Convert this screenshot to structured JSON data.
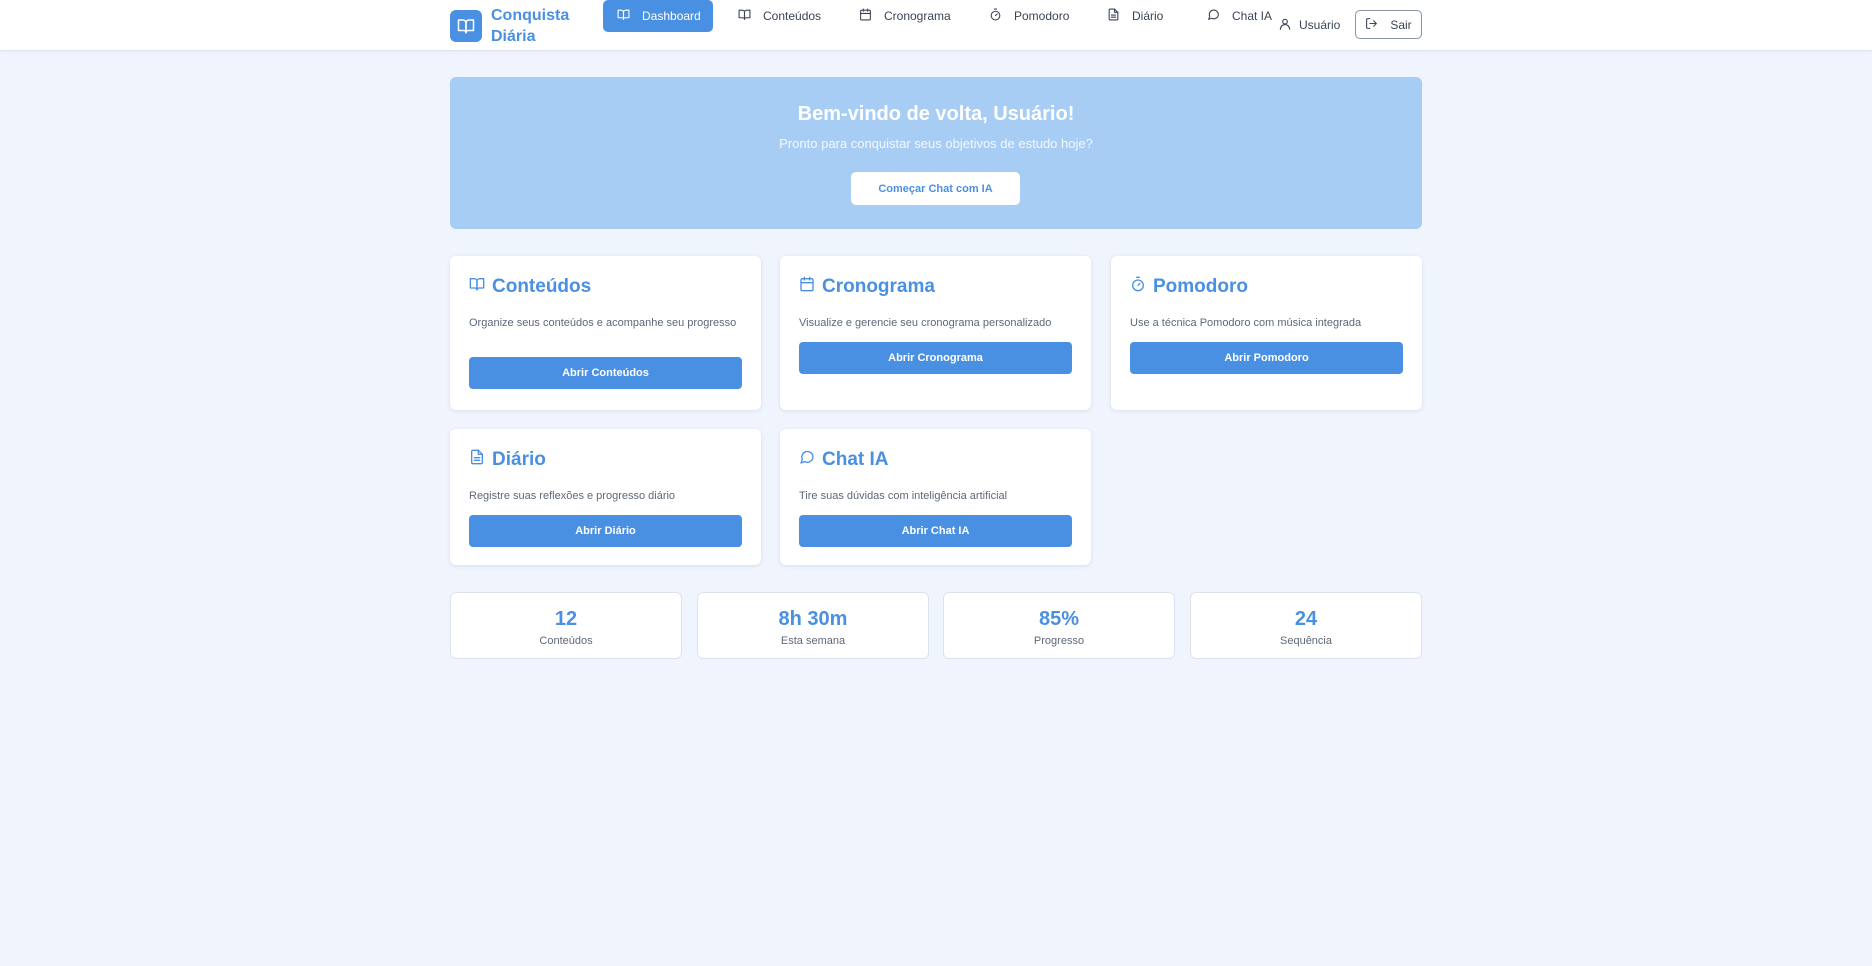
{
  "app": {
    "name": "Conquista Diária"
  },
  "nav": {
    "items": [
      {
        "label": "Dashboard",
        "icon": "book-open-icon",
        "active": true
      },
      {
        "label": "Conteúdos",
        "icon": "book-open-icon"
      },
      {
        "label": "Cronograma",
        "icon": "calendar-icon"
      },
      {
        "label": "Pomodoro",
        "icon": "timer-icon"
      },
      {
        "label": "Diário",
        "icon": "file-text-icon"
      },
      {
        "label": "Chat IA",
        "icon": "message-circle-icon"
      }
    ],
    "user_label": "Usuário",
    "logout_label": "Sair"
  },
  "hero": {
    "title": "Bem-vindo de volta, Usuário!",
    "subtitle": "Pronto para conquistar seus objetivos de estudo hoje?",
    "cta_label": "Começar Chat com IA"
  },
  "cards": [
    {
      "title": "Conteúdos",
      "icon": "book-open-icon",
      "description": "Organize seus conteúdos e acompanhe seu progresso",
      "button_label": "Abrir Conteúdos"
    },
    {
      "title": "Cronograma",
      "icon": "calendar-icon",
      "description": "Visualize e gerencie seu cronograma personalizado",
      "button_label": "Abrir Cronograma"
    },
    {
      "title": "Pomodoro",
      "icon": "timer-icon",
      "description": "Use a técnica Pomodoro com música integrada",
      "button_label": "Abrir Pomodoro"
    },
    {
      "title": "Diário",
      "icon": "file-text-icon",
      "description": "Registre suas reflexões e progresso diário",
      "button_label": "Abrir Diário"
    },
    {
      "title": "Chat IA",
      "icon": "message-circle-icon",
      "description": "Tire suas dúvidas com inteligência artificial",
      "button_label": "Abrir Chat IA"
    }
  ],
  "stats": [
    {
      "value": "12",
      "label": "Conteúdos"
    },
    {
      "value": "8h 30m",
      "label": "Esta semana"
    },
    {
      "value": "85%",
      "label": "Progresso"
    },
    {
      "value": "24",
      "label": "Sequência"
    }
  ],
  "colors": {
    "accent": "#4a90e2",
    "hero_background": "#a8cdf5",
    "page_background": "#f0f5fd"
  }
}
